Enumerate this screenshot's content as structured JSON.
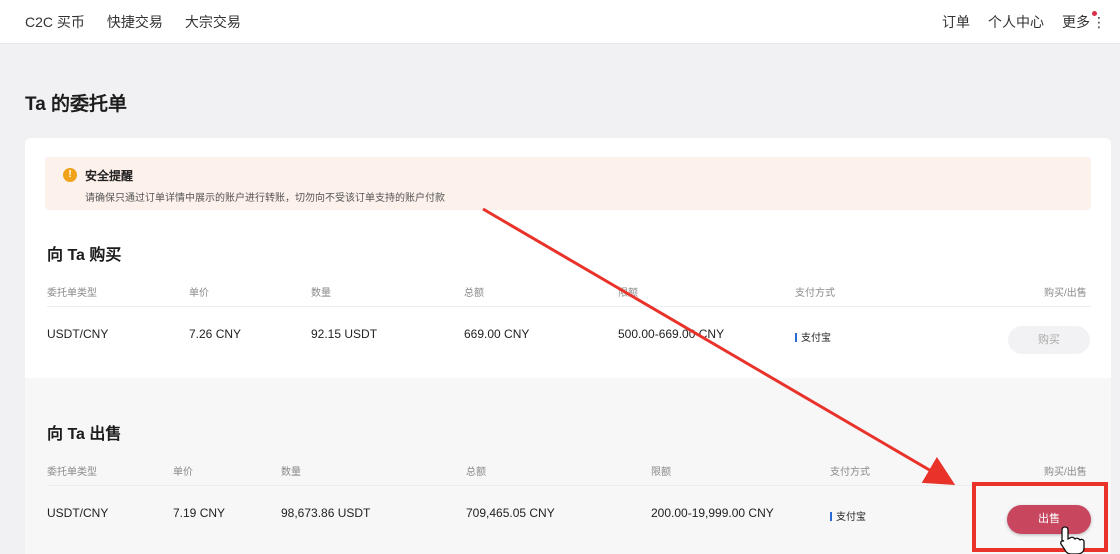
{
  "topnav": {
    "left_links": [
      "C2C 买币",
      "快捷交易",
      "大宗交易"
    ],
    "right_links": [
      "订单",
      "个人中心"
    ],
    "more_label": "更多",
    "more_icon": "⋮"
  },
  "page": {
    "title": "Ta 的委托单"
  },
  "notice": {
    "icon": "!",
    "title": "安全提醒",
    "text": "请确保只通过订单详情中展示的账户进行转账，切勿向不受该订单支持的账户付款"
  },
  "buy_section": {
    "title": "向 Ta 购买",
    "headers": [
      "委托单类型",
      "单价",
      "数量",
      "总额",
      "限额",
      "支付方式",
      "购买/出售"
    ],
    "row": {
      "pair": "USDT/CNY",
      "price": "7.26 CNY",
      "quantity": "92.15 USDT",
      "total": "669.00 CNY",
      "limit": "500.00-669.00 CNY",
      "payment": "支付宝",
      "action": "购买"
    }
  },
  "sell_section": {
    "title": "向 Ta 出售",
    "headers": [
      "委托单类型",
      "单价",
      "数量",
      "总额",
      "限额",
      "支付方式",
      "购买/出售"
    ],
    "row": {
      "pair": "USDT/CNY",
      "price": "7.19 CNY",
      "quantity": "98,673.86 USDT",
      "total": "709,465.05 CNY",
      "limit": "200.00-19,999.00 CNY",
      "payment": "支付宝",
      "action": "出售"
    }
  },
  "colors": {
    "annotation_red": "#e8322a",
    "sell_button": "#c8475f",
    "notice_bg": "#fdf1ec",
    "alipay_blue": "#2a6ad3"
  },
  "icons": {
    "notice": "warning-icon",
    "cursor": "hand-pointer-icon"
  }
}
